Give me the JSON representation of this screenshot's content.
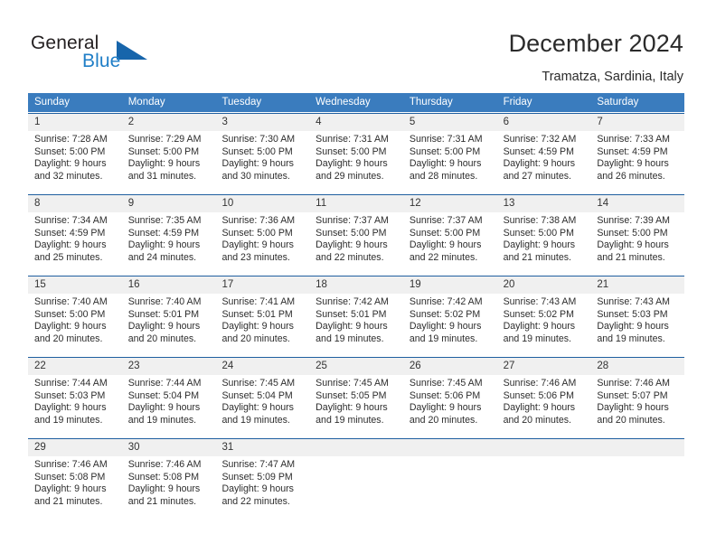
{
  "brand": {
    "word_one": "General",
    "word_two": "Blue",
    "triangle_icon": "triangle-icon"
  },
  "header": {
    "title": "December 2024",
    "subtitle": "Tramatza, Sardinia, Italy"
  },
  "colors": {
    "header_blue": "#3a7cbe",
    "rule_blue": "#1f5fa0",
    "brand_blue": "#1f7ec7",
    "date_band": "#f0f0f0",
    "text": "#2d2d2d"
  },
  "calendar": {
    "day_names": [
      "Sunday",
      "Monday",
      "Tuesday",
      "Wednesday",
      "Thursday",
      "Friday",
      "Saturday"
    ],
    "weeks": [
      [
        {
          "day": "1",
          "sunrise": "Sunrise: 7:28 AM",
          "sunset": "Sunset: 5:00 PM",
          "daylight_1": "Daylight: 9 hours",
          "daylight_2": "and 32 minutes."
        },
        {
          "day": "2",
          "sunrise": "Sunrise: 7:29 AM",
          "sunset": "Sunset: 5:00 PM",
          "daylight_1": "Daylight: 9 hours",
          "daylight_2": "and 31 minutes."
        },
        {
          "day": "3",
          "sunrise": "Sunrise: 7:30 AM",
          "sunset": "Sunset: 5:00 PM",
          "daylight_1": "Daylight: 9 hours",
          "daylight_2": "and 30 minutes."
        },
        {
          "day": "4",
          "sunrise": "Sunrise: 7:31 AM",
          "sunset": "Sunset: 5:00 PM",
          "daylight_1": "Daylight: 9 hours",
          "daylight_2": "and 29 minutes."
        },
        {
          "day": "5",
          "sunrise": "Sunrise: 7:31 AM",
          "sunset": "Sunset: 5:00 PM",
          "daylight_1": "Daylight: 9 hours",
          "daylight_2": "and 28 minutes."
        },
        {
          "day": "6",
          "sunrise": "Sunrise: 7:32 AM",
          "sunset": "Sunset: 4:59 PM",
          "daylight_1": "Daylight: 9 hours",
          "daylight_2": "and 27 minutes."
        },
        {
          "day": "7",
          "sunrise": "Sunrise: 7:33 AM",
          "sunset": "Sunset: 4:59 PM",
          "daylight_1": "Daylight: 9 hours",
          "daylight_2": "and 26 minutes."
        }
      ],
      [
        {
          "day": "8",
          "sunrise": "Sunrise: 7:34 AM",
          "sunset": "Sunset: 4:59 PM",
          "daylight_1": "Daylight: 9 hours",
          "daylight_2": "and 25 minutes."
        },
        {
          "day": "9",
          "sunrise": "Sunrise: 7:35 AM",
          "sunset": "Sunset: 4:59 PM",
          "daylight_1": "Daylight: 9 hours",
          "daylight_2": "and 24 minutes."
        },
        {
          "day": "10",
          "sunrise": "Sunrise: 7:36 AM",
          "sunset": "Sunset: 5:00 PM",
          "daylight_1": "Daylight: 9 hours",
          "daylight_2": "and 23 minutes."
        },
        {
          "day": "11",
          "sunrise": "Sunrise: 7:37 AM",
          "sunset": "Sunset: 5:00 PM",
          "daylight_1": "Daylight: 9 hours",
          "daylight_2": "and 22 minutes."
        },
        {
          "day": "12",
          "sunrise": "Sunrise: 7:37 AM",
          "sunset": "Sunset: 5:00 PM",
          "daylight_1": "Daylight: 9 hours",
          "daylight_2": "and 22 minutes."
        },
        {
          "day": "13",
          "sunrise": "Sunrise: 7:38 AM",
          "sunset": "Sunset: 5:00 PM",
          "daylight_1": "Daylight: 9 hours",
          "daylight_2": "and 21 minutes."
        },
        {
          "day": "14",
          "sunrise": "Sunrise: 7:39 AM",
          "sunset": "Sunset: 5:00 PM",
          "daylight_1": "Daylight: 9 hours",
          "daylight_2": "and 21 minutes."
        }
      ],
      [
        {
          "day": "15",
          "sunrise": "Sunrise: 7:40 AM",
          "sunset": "Sunset: 5:00 PM",
          "daylight_1": "Daylight: 9 hours",
          "daylight_2": "and 20 minutes."
        },
        {
          "day": "16",
          "sunrise": "Sunrise: 7:40 AM",
          "sunset": "Sunset: 5:01 PM",
          "daylight_1": "Daylight: 9 hours",
          "daylight_2": "and 20 minutes."
        },
        {
          "day": "17",
          "sunrise": "Sunrise: 7:41 AM",
          "sunset": "Sunset: 5:01 PM",
          "daylight_1": "Daylight: 9 hours",
          "daylight_2": "and 20 minutes."
        },
        {
          "day": "18",
          "sunrise": "Sunrise: 7:42 AM",
          "sunset": "Sunset: 5:01 PM",
          "daylight_1": "Daylight: 9 hours",
          "daylight_2": "and 19 minutes."
        },
        {
          "day": "19",
          "sunrise": "Sunrise: 7:42 AM",
          "sunset": "Sunset: 5:02 PM",
          "daylight_1": "Daylight: 9 hours",
          "daylight_2": "and 19 minutes."
        },
        {
          "day": "20",
          "sunrise": "Sunrise: 7:43 AM",
          "sunset": "Sunset: 5:02 PM",
          "daylight_1": "Daylight: 9 hours",
          "daylight_2": "and 19 minutes."
        },
        {
          "day": "21",
          "sunrise": "Sunrise: 7:43 AM",
          "sunset": "Sunset: 5:03 PM",
          "daylight_1": "Daylight: 9 hours",
          "daylight_2": "and 19 minutes."
        }
      ],
      [
        {
          "day": "22",
          "sunrise": "Sunrise: 7:44 AM",
          "sunset": "Sunset: 5:03 PM",
          "daylight_1": "Daylight: 9 hours",
          "daylight_2": "and 19 minutes."
        },
        {
          "day": "23",
          "sunrise": "Sunrise: 7:44 AM",
          "sunset": "Sunset: 5:04 PM",
          "daylight_1": "Daylight: 9 hours",
          "daylight_2": "and 19 minutes."
        },
        {
          "day": "24",
          "sunrise": "Sunrise: 7:45 AM",
          "sunset": "Sunset: 5:04 PM",
          "daylight_1": "Daylight: 9 hours",
          "daylight_2": "and 19 minutes."
        },
        {
          "day": "25",
          "sunrise": "Sunrise: 7:45 AM",
          "sunset": "Sunset: 5:05 PM",
          "daylight_1": "Daylight: 9 hours",
          "daylight_2": "and 19 minutes."
        },
        {
          "day": "26",
          "sunrise": "Sunrise: 7:45 AM",
          "sunset": "Sunset: 5:06 PM",
          "daylight_1": "Daylight: 9 hours",
          "daylight_2": "and 20 minutes."
        },
        {
          "day": "27",
          "sunrise": "Sunrise: 7:46 AM",
          "sunset": "Sunset: 5:06 PM",
          "daylight_1": "Daylight: 9 hours",
          "daylight_2": "and 20 minutes."
        },
        {
          "day": "28",
          "sunrise": "Sunrise: 7:46 AM",
          "sunset": "Sunset: 5:07 PM",
          "daylight_1": "Daylight: 9 hours",
          "daylight_2": "and 20 minutes."
        }
      ],
      [
        {
          "day": "29",
          "sunrise": "Sunrise: 7:46 AM",
          "sunset": "Sunset: 5:08 PM",
          "daylight_1": "Daylight: 9 hours",
          "daylight_2": "and 21 minutes."
        },
        {
          "day": "30",
          "sunrise": "Sunrise: 7:46 AM",
          "sunset": "Sunset: 5:08 PM",
          "daylight_1": "Daylight: 9 hours",
          "daylight_2": "and 21 minutes."
        },
        {
          "day": "31",
          "sunrise": "Sunrise: 7:47 AM",
          "sunset": "Sunset: 5:09 PM",
          "daylight_1": "Daylight: 9 hours",
          "daylight_2": "and 22 minutes."
        },
        {
          "day": "",
          "sunrise": "",
          "sunset": "",
          "daylight_1": "",
          "daylight_2": ""
        },
        {
          "day": "",
          "sunrise": "",
          "sunset": "",
          "daylight_1": "",
          "daylight_2": ""
        },
        {
          "day": "",
          "sunrise": "",
          "sunset": "",
          "daylight_1": "",
          "daylight_2": ""
        },
        {
          "day": "",
          "sunrise": "",
          "sunset": "",
          "daylight_1": "",
          "daylight_2": ""
        }
      ]
    ]
  }
}
